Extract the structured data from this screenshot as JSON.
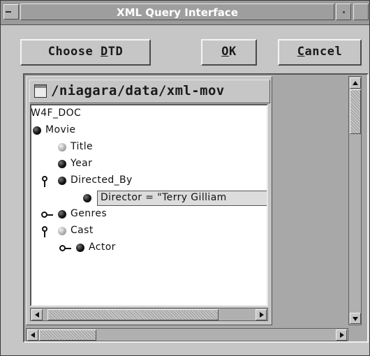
{
  "window": {
    "title": "XML Query Interface"
  },
  "buttons": {
    "choose_dtd": {
      "prefix": "Choose ",
      "mnemonic": "D",
      "suffix": "TD"
    },
    "ok": {
      "prefix": "",
      "mnemonic": "O",
      "suffix": "K"
    },
    "cancel": {
      "prefix": "",
      "mnemonic": "C",
      "suffix": "ancel"
    }
  },
  "path": {
    "text": "/niagara/data/xml-mov",
    "icon": "folder-icon"
  },
  "tree": {
    "root": "W4F_DOC",
    "movie": "Movie",
    "title": "Title",
    "year": "Year",
    "directed_by": "Directed_By",
    "director": "Director = \"Terry Gilliam",
    "genres": "Genres",
    "cast": "Cast",
    "actor": "Actor"
  }
}
